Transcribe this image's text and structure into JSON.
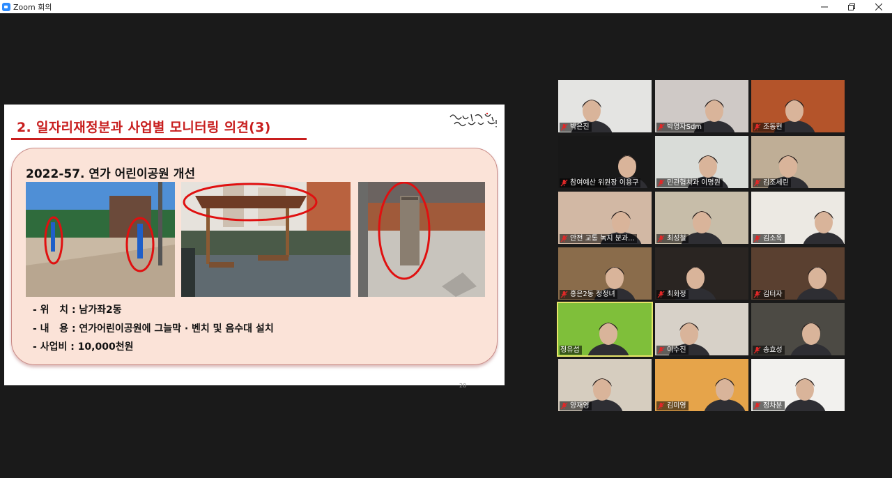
{
  "window": {
    "title": "Zoom 회의"
  },
  "slide": {
    "heading": "2. 일자리재정분과 사업별 모니터링 의견(3)",
    "logo_text": "행복100% 서대문!",
    "project_title": "2022-57. 연가 어린이공원 개선",
    "details": [
      "- 위   치 : 남가좌2동",
      "- 내   용 : 연가어린이공원에 그늘막 · 벤치 및 음수대 설치",
      "- 사업비 : 10,000천원"
    ],
    "page_number": "20"
  },
  "participants": [
    {
      "name": "박은진",
      "muted": true,
      "bg": "#e4e4e2"
    },
    {
      "name": "박영자Sdm",
      "muted": true,
      "bg": "#cfc9c6"
    },
    {
      "name": "조동현",
      "muted": true,
      "bg": "#b4542a"
    },
    {
      "name": "참여예산 위원장 이용구",
      "muted": true,
      "bg": "#181818"
    },
    {
      "name": "민관협치과 이명원",
      "muted": true,
      "bg": "#d9dcd8"
    },
    {
      "name": "김조세린",
      "muted": true,
      "bg": "#bfae96"
    },
    {
      "name": "안전 교통 녹지 분과...",
      "muted": true,
      "bg": "#d2b8a4"
    },
    {
      "name": "최성철",
      "muted": true,
      "bg": "#c7bda9"
    },
    {
      "name": "김소옥",
      "muted": true,
      "bg": "#ece9e3"
    },
    {
      "name": "홍은2동 정정녀",
      "muted": true,
      "bg": "#8a6c4b"
    },
    {
      "name": "최화정",
      "muted": true,
      "bg": "#2a2522"
    },
    {
      "name": "김터자",
      "muted": true,
      "bg": "#5a4030"
    },
    {
      "name": "정유섭",
      "muted": false,
      "bg": "#7fbf3a"
    },
    {
      "name": "이수진",
      "muted": true,
      "bg": "#d7d1c8"
    },
    {
      "name": "송효성",
      "muted": true,
      "bg": "#4c4a44"
    },
    {
      "name": "양재영",
      "muted": true,
      "bg": "#d6cdbf"
    },
    {
      "name": "김미영",
      "muted": true,
      "bg": "#e6a44a"
    },
    {
      "name": "정차분",
      "muted": true,
      "bg": "#f2f1ee"
    }
  ],
  "colors": {
    "accent": "#c81e1e",
    "active_speaker": "#e8e56a",
    "muted_icon": "#e02828"
  }
}
